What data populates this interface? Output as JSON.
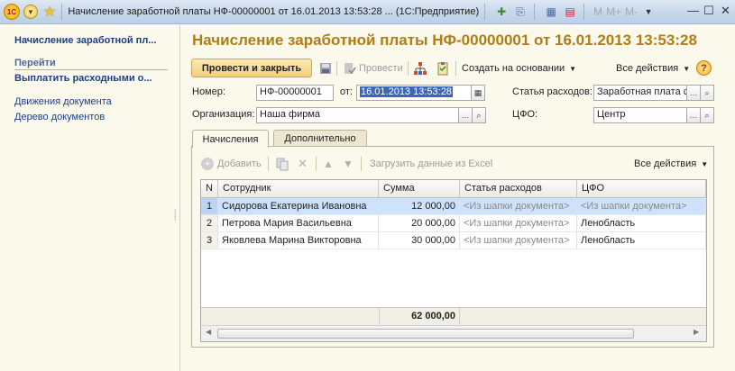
{
  "window": {
    "title": "Начисление заработной платы НФ-00000001 от 16.01.2013 13:53:28 ...  (1С:Предприятие)",
    "logo_text": "1С",
    "m_labels": [
      "M",
      "M+",
      "M-"
    ]
  },
  "left": {
    "title": "Начисление заработной пл...",
    "section": "Перейти",
    "items": [
      "Выплатить расходными о...",
      "Движения документа",
      "Дерево документов"
    ]
  },
  "page_title": "Начисление заработной платы НФ-00000001 от 16.01.2013 13:53:28",
  "toolbar": {
    "post_close": "Провести и закрыть",
    "post": "Провести",
    "create_based": "Создать на основании",
    "all_actions": "Все действия",
    "help": "?"
  },
  "form": {
    "number_label": "Номер:",
    "number_value": "НФ-00000001",
    "date_label": "от:",
    "date_value": "16.01.2013 13:53:28",
    "expense_label": "Статья расходов:",
    "expense_value": "Заработная плата с",
    "org_label": "Организация:",
    "org_value": "Наша фирма",
    "cfo_label": "ЦФО:",
    "cfo_value": "Центр"
  },
  "tabs": [
    "Начисления",
    "Дополнительно"
  ],
  "table_toolbar": {
    "add": "Добавить",
    "load_excel": "Загрузить данные из Excel",
    "all_actions": "Все действия"
  },
  "table": {
    "headers": [
      "N",
      "Сотрудник",
      "Сумма",
      "Статья расходов",
      "ЦФО"
    ],
    "rows": [
      [
        "1",
        "Сидорова Екатерина Ивановна",
        "12 000,00",
        "<Из шапки документа>",
        "<Из шапки документа>"
      ],
      [
        "2",
        "Петрова Мария Васильевна",
        "20 000,00",
        "<Из шапки документа>",
        "Ленобласть"
      ],
      [
        "3",
        "Яковлева Марина Викторовна",
        "30 000,00",
        "<Из шапки документа>",
        "Ленобласть"
      ]
    ],
    "total": "62 000,00"
  }
}
